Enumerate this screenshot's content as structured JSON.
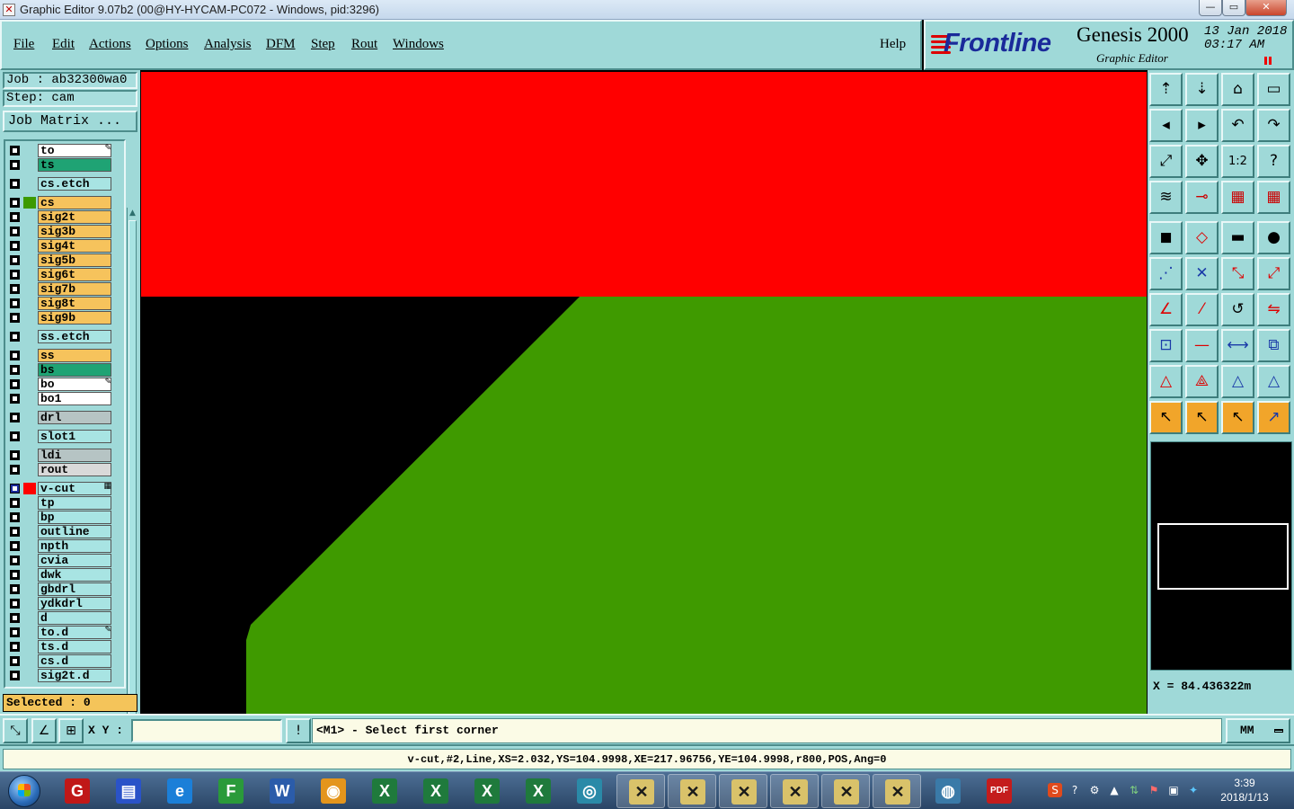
{
  "window": {
    "title": "Graphic Editor 9.07b2 (00@HY-HYCAM-PC072 - Windows, pid:3296)",
    "controls": [
      "—",
      "▭",
      "✕"
    ]
  },
  "menubar": {
    "items": [
      {
        "label": "File"
      },
      {
        "label": "Edit"
      },
      {
        "label": "Actions"
      },
      {
        "label": "Options"
      },
      {
        "label": "Analysis"
      },
      {
        "label": "DFM"
      },
      {
        "label": "Step"
      },
      {
        "label": "Rout"
      },
      {
        "label": "Windows"
      }
    ],
    "help": "Help"
  },
  "brand": {
    "logo": "Frontline",
    "product": "Genesis 2000",
    "subtitle": "Graphic Editor",
    "date": "13 Jan 2018",
    "time": "03:17 AM"
  },
  "left": {
    "job": "Job : ab32300wa0",
    "step": "Step: cam",
    "job_matrix": "Job Matrix ...",
    "selected": "Selected : 0",
    "layers": [
      {
        "name": "to",
        "color": "#ffffff",
        "swatch": "",
        "mark": "✎"
      },
      {
        "name": "ts",
        "color": "#1fa374",
        "swatch": "",
        "mark": ""
      },
      {
        "name": "cs.etch",
        "color": "#a8e4e3",
        "swatch": "",
        "mark": ""
      },
      {
        "name": "cs",
        "color": "#f6c35c",
        "swatch": "#3c9a00",
        "mark": ""
      },
      {
        "name": "sig2t",
        "color": "#f6c35c",
        "swatch": "",
        "mark": ""
      },
      {
        "name": "sig3b",
        "color": "#f6c35c",
        "swatch": "",
        "mark": ""
      },
      {
        "name": "sig4t",
        "color": "#f6c35c",
        "swatch": "",
        "mark": ""
      },
      {
        "name": "sig5b",
        "color": "#f6c35c",
        "swatch": "",
        "mark": ""
      },
      {
        "name": "sig6t",
        "color": "#f6c35c",
        "swatch": "",
        "mark": ""
      },
      {
        "name": "sig7b",
        "color": "#f6c35c",
        "swatch": "",
        "mark": ""
      },
      {
        "name": "sig8t",
        "color": "#f6c35c",
        "swatch": "",
        "mark": ""
      },
      {
        "name": "sig9b",
        "color": "#f6c35c",
        "swatch": "",
        "mark": ""
      },
      {
        "name": "ss.etch",
        "color": "#a8e4e3",
        "swatch": "",
        "mark": ""
      },
      {
        "name": "ss",
        "color": "#f6c35c",
        "swatch": "",
        "mark": ""
      },
      {
        "name": "bs",
        "color": "#1fa374",
        "swatch": "",
        "mark": ""
      },
      {
        "name": "bo",
        "color": "#ffffff",
        "swatch": "",
        "mark": "✎"
      },
      {
        "name": "bo1",
        "color": "#ffffff",
        "swatch": "",
        "mark": ""
      },
      {
        "name": "drl",
        "color": "#b6c4c4",
        "swatch": "",
        "mark": ""
      },
      {
        "name": "slot1",
        "color": "#a8e4e3",
        "swatch": "",
        "mark": ""
      },
      {
        "name": "ldi",
        "color": "#b6c4c4",
        "swatch": "",
        "mark": ""
      },
      {
        "name": "rout",
        "color": "#d9d9d9",
        "swatch": "",
        "mark": ""
      },
      {
        "name": "v-cut",
        "color": "#a8e4e3",
        "swatch": "#ff0000",
        "mark": "▦"
      },
      {
        "name": "tp",
        "color": "#a8e4e3",
        "swatch": "",
        "mark": ""
      },
      {
        "name": "bp",
        "color": "#a8e4e3",
        "swatch": "",
        "mark": ""
      },
      {
        "name": "outline",
        "color": "#a8e4e3",
        "swatch": "",
        "mark": ""
      },
      {
        "name": "npth",
        "color": "#a8e4e3",
        "swatch": "",
        "mark": ""
      },
      {
        "name": "cvia",
        "color": "#a8e4e3",
        "swatch": "",
        "mark": ""
      },
      {
        "name": "dwk",
        "color": "#a8e4e3",
        "swatch": "",
        "mark": ""
      },
      {
        "name": "gbdrl",
        "color": "#a8e4e3",
        "swatch": "",
        "mark": ""
      },
      {
        "name": "ydkdrl",
        "color": "#a8e4e3",
        "swatch": "",
        "mark": ""
      },
      {
        "name": "d",
        "color": "#a8e4e3",
        "swatch": "",
        "mark": ""
      },
      {
        "name": "to.d",
        "color": "#a8e4e3",
        "swatch": "",
        "mark": "✎"
      },
      {
        "name": "ts.d",
        "color": "#a8e4e3",
        "swatch": "",
        "mark": ""
      },
      {
        "name": "cs.d",
        "color": "#a8e4e3",
        "swatch": "",
        "mark": ""
      },
      {
        "name": "sig2t.d",
        "color": "#a8e4e3",
        "swatch": "",
        "mark": ""
      }
    ]
  },
  "canvas": {
    "colors": {
      "red_layer": "#ff0000",
      "green_layer": "#3f9a00",
      "background": "#000000"
    }
  },
  "right": {
    "coord": "X = 84.436322m"
  },
  "command": {
    "xy_label": "X Y :",
    "xy_value": "",
    "prompt": "<M1> - Select first corner",
    "units": "MM"
  },
  "status": {
    "message": "v-cut,#2,Line,XS=2.032,YS=104.9998,XE=217.96756,YE=104.9998,r800,POS,Ang=0"
  },
  "taskbar": {
    "clock_time": "3:39",
    "clock_date": "2018/1/13",
    "apps": [
      {
        "name": "genesis-app-icon",
        "glyph": "G",
        "bg": "#c01818"
      },
      {
        "name": "floppy-save-icon",
        "glyph": "▤",
        "bg": "#2a53c8"
      },
      {
        "name": "internet-explorer-icon",
        "glyph": "e",
        "bg": "#1b7fd8"
      },
      {
        "name": "frontline-f-icon",
        "glyph": "F",
        "bg": "#2a9a3a"
      },
      {
        "name": "word-document-icon",
        "glyph": "W",
        "bg": "#2b5caa"
      },
      {
        "name": "shell-app-icon",
        "glyph": "◉",
        "bg": "#e4951c"
      },
      {
        "name": "excel-icon-1",
        "glyph": "X",
        "bg": "#1f7a3c"
      },
      {
        "name": "excel-icon-2",
        "glyph": "X",
        "bg": "#1f7a3c"
      },
      {
        "name": "excel-icon-3",
        "glyph": "X",
        "bg": "#1f7a3c"
      },
      {
        "name": "excel-icon-4",
        "glyph": "X",
        "bg": "#1f7a3c"
      },
      {
        "name": "eye-app-icon",
        "glyph": "◎",
        "bg": "#2a8aa8"
      },
      {
        "name": "graphic-editor-window-1",
        "glyph": "✕",
        "bg": "#d9c26a"
      },
      {
        "name": "graphic-editor-window-2",
        "glyph": "✕",
        "bg": "#d9c26a"
      },
      {
        "name": "graphic-editor-window-3",
        "glyph": "✕",
        "bg": "#d9c26a"
      },
      {
        "name": "graphic-editor-window-4",
        "glyph": "✕",
        "bg": "#d9c26a"
      },
      {
        "name": "graphic-editor-window-5",
        "glyph": "✕",
        "bg": "#d9c26a"
      },
      {
        "name": "graphic-editor-window-6",
        "glyph": "✕",
        "bg": "#d9c26a"
      },
      {
        "name": "network-app-icon",
        "glyph": "◍",
        "bg": "#3a7aa8"
      },
      {
        "name": "pdf-reader-icon",
        "glyph": "PDF",
        "bg": "#c41c1c"
      }
    ]
  }
}
